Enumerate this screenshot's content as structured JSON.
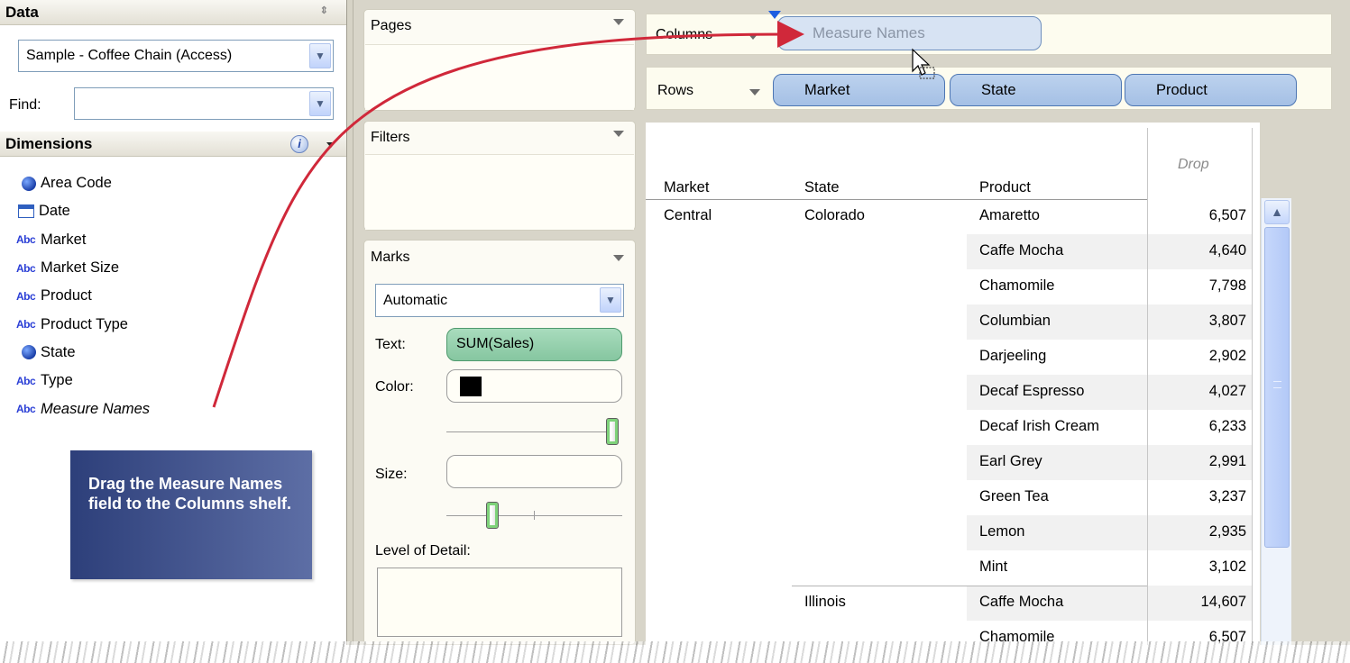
{
  "data_pane": {
    "title": "Data",
    "datasource": "Sample - Coffee Chain (Access)",
    "find_label": "Find:",
    "find_value": "",
    "dimensions_title": "Dimensions",
    "fields": [
      {
        "label": "Area Code",
        "icon": "globe-icon"
      },
      {
        "label": "Date",
        "icon": "calendar-icon"
      },
      {
        "label": "Market",
        "icon": "abc-icon"
      },
      {
        "label": "Market Size",
        "icon": "abc-icon"
      },
      {
        "label": "Product",
        "icon": "abc-icon"
      },
      {
        "label": "Product Type",
        "icon": "abc-icon"
      },
      {
        "label": "State",
        "icon": "globe-icon"
      },
      {
        "label": "Type",
        "icon": "abc-icon"
      },
      {
        "label": "Measure Names",
        "icon": "abc-icon"
      }
    ],
    "abc_glyph": "Abc"
  },
  "callout": {
    "text": "Drag the Measure Names field to the Columns shelf."
  },
  "cards": {
    "pages_title": "Pages",
    "filters_title": "Filters",
    "marks_title": "Marks",
    "mark_type": "Automatic",
    "text_label": "Text:",
    "text_pill": "SUM(Sales)",
    "color_label": "Color:",
    "color_value": "#000000",
    "size_label": "Size:",
    "detail_label": "Level of Detail:"
  },
  "shelves": {
    "columns_label": "Columns",
    "rows_label": "Rows",
    "columns_ghost": "Measure Names",
    "rows_pills": [
      "Market",
      "State",
      "Product"
    ]
  },
  "table": {
    "drop_label": "Drop",
    "headers": [
      "Market",
      "State",
      "Product"
    ],
    "rows": [
      {
        "market": "Central",
        "state": "Colorado",
        "product": "Amaretto",
        "value": "6,507"
      },
      {
        "market": "",
        "state": "",
        "product": "Caffe Mocha",
        "value": "4,640"
      },
      {
        "market": "",
        "state": "",
        "product": "Chamomile",
        "value": "7,798"
      },
      {
        "market": "",
        "state": "",
        "product": "Columbian",
        "value": "3,807"
      },
      {
        "market": "",
        "state": "",
        "product": "Darjeeling",
        "value": "2,902"
      },
      {
        "market": "",
        "state": "",
        "product": "Decaf Espresso",
        "value": "4,027"
      },
      {
        "market": "",
        "state": "",
        "product": "Decaf Irish Cream",
        "value": "6,233"
      },
      {
        "market": "",
        "state": "",
        "product": "Earl Grey",
        "value": "2,991"
      },
      {
        "market": "",
        "state": "",
        "product": "Green Tea",
        "value": "3,237"
      },
      {
        "market": "",
        "state": "",
        "product": "Lemon",
        "value": "2,935"
      },
      {
        "market": "",
        "state": "",
        "product": "Mint",
        "value": "3,102"
      },
      {
        "market": "",
        "state": "Illinois",
        "product": "Caffe Mocha",
        "value": "14,607"
      },
      {
        "market": "",
        "state": "",
        "product": "Chamomile",
        "value": "6,507"
      }
    ]
  },
  "colors": {
    "pill_blue": "#a5c0e5",
    "pill_green": "#8fcaa7",
    "callout": "#3d4f8a",
    "arrow": "#d0283a"
  }
}
